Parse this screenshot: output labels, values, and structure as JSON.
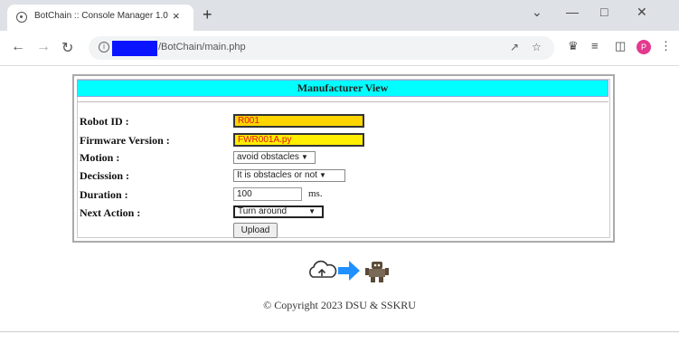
{
  "browser": {
    "tab_title": "BotChain :: Console Manager 1.0",
    "tab_close": "×",
    "new_tab": "+",
    "url": "/BotChain/main.php",
    "profile_initial": "P"
  },
  "page": {
    "header": "Manufacturer View",
    "fields": {
      "robot_id": {
        "label": "Robot ID :",
        "value": "R001"
      },
      "firmware": {
        "label": "Firmware Version :",
        "value": "FWR001A.py"
      },
      "motion": {
        "label": "Motion :",
        "value": "avoid obstacles"
      },
      "decission": {
        "label": "Decission :",
        "value": "It is obstacles or not"
      },
      "duration": {
        "label": "Duration :",
        "value": "100",
        "unit": "ms."
      },
      "next_action": {
        "label": "Next Action :",
        "value": "Turn around"
      }
    },
    "upload_label": "Upload",
    "copyright": "© Copyright 2023 DSU & SSKRU"
  },
  "icons": [
    "cloud-upload-icon",
    "arrow-right-icon",
    "robot-icon"
  ],
  "colors": {
    "header_bg": "#00ffff",
    "input_yellow": "#ffd500",
    "arrow_blue": "#1e90ff"
  }
}
